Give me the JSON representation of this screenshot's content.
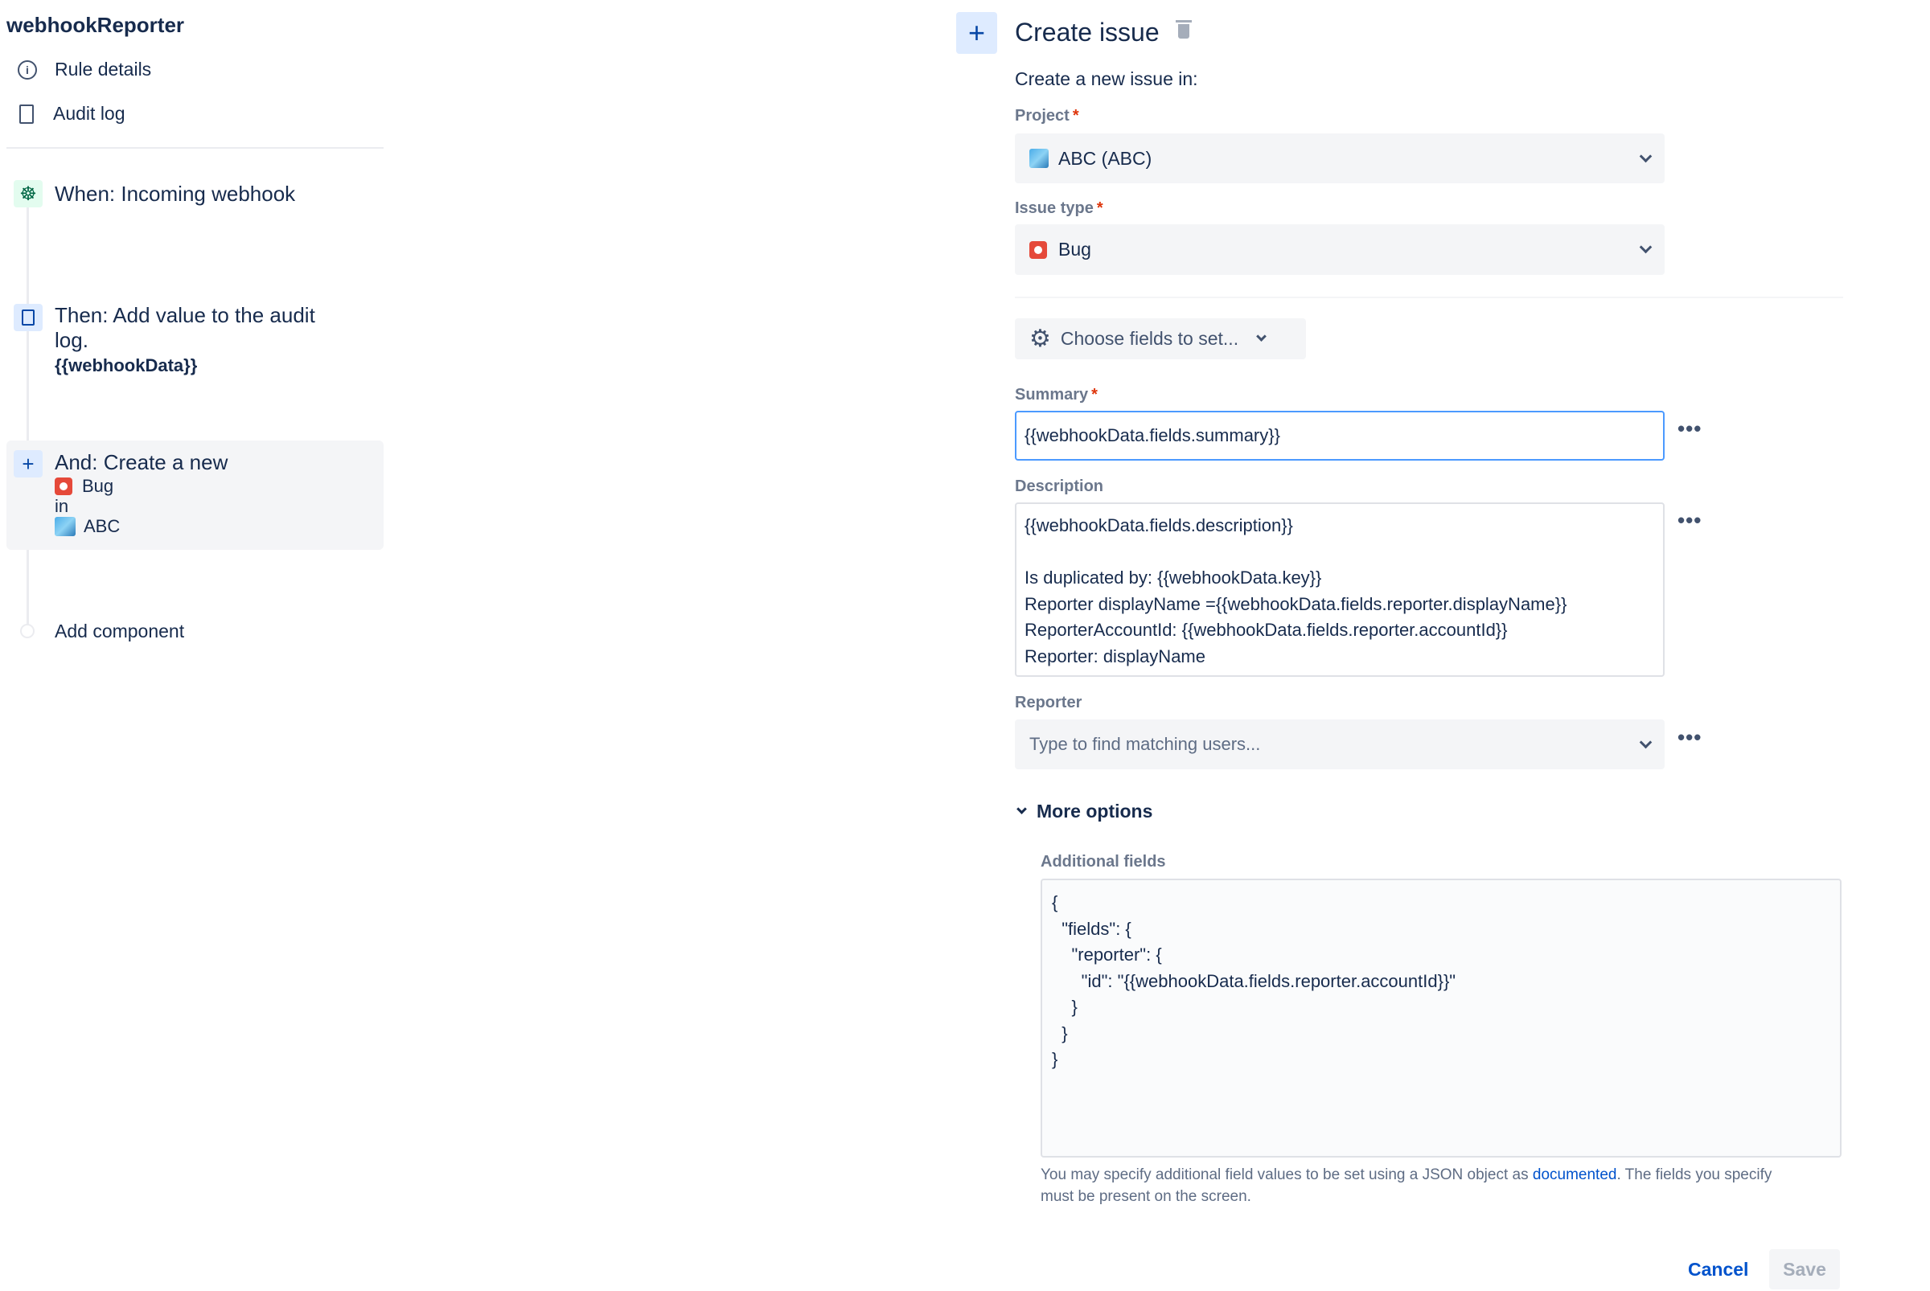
{
  "sidebar": {
    "title": "webhookReporter",
    "nav": [
      {
        "label": "Rule details",
        "icon": "info-icon"
      },
      {
        "label": "Audit log",
        "icon": "document-icon"
      }
    ],
    "steps": {
      "trigger": "When: Incoming webhook",
      "action1_line1": "Then: Add value to the audit",
      "action1_line2": "log.",
      "action1_value": "{{webhookData}}",
      "action2_title": "And: Create a new",
      "action2_type": "Bug",
      "action2_in": "in",
      "action2_project": "ABC",
      "add": "Add component"
    }
  },
  "panel": {
    "title": "Create issue",
    "intro": "Create a new issue in:",
    "project": {
      "label": "Project",
      "value": "ABC (ABC)"
    },
    "issue_type": {
      "label": "Issue type",
      "value": "Bug"
    },
    "choose_fields": "Choose fields to set...",
    "summary": {
      "label": "Summary",
      "value": "{{webhookData.fields.summary}}"
    },
    "description": {
      "label": "Description",
      "lines": [
        "{{webhookData.fields.description}}",
        "",
        "Is duplicated by: {{webhookData.key}}",
        "Reporter displayName ={{webhookData.fields.reporter.displayName}}",
        "ReporterAccountId: {{webhookData.fields.reporter.accountId}}",
        "Reporter: displayName"
      ]
    },
    "reporter": {
      "label": "Reporter",
      "placeholder": "Type to find matching users..."
    },
    "more_options": "More options",
    "additional": {
      "label": "Additional fields",
      "lines": [
        "{",
        "  \"fields\": {",
        "    \"reporter\": {",
        "      \"id\": \"{{webhookData.fields.reporter.accountId}}\"",
        "    }",
        "  }",
        "}"
      ],
      "help_before": "You may specify additional field values to be set using a JSON object as ",
      "help_link": "documented",
      "help_after": ". The fields you specify",
      "help_line2": "must be present on the screen."
    },
    "cancel": "Cancel",
    "save": "Save"
  },
  "colors": {
    "accent": "#0052cc",
    "required": "#de350b",
    "bug": "#e5493a"
  }
}
